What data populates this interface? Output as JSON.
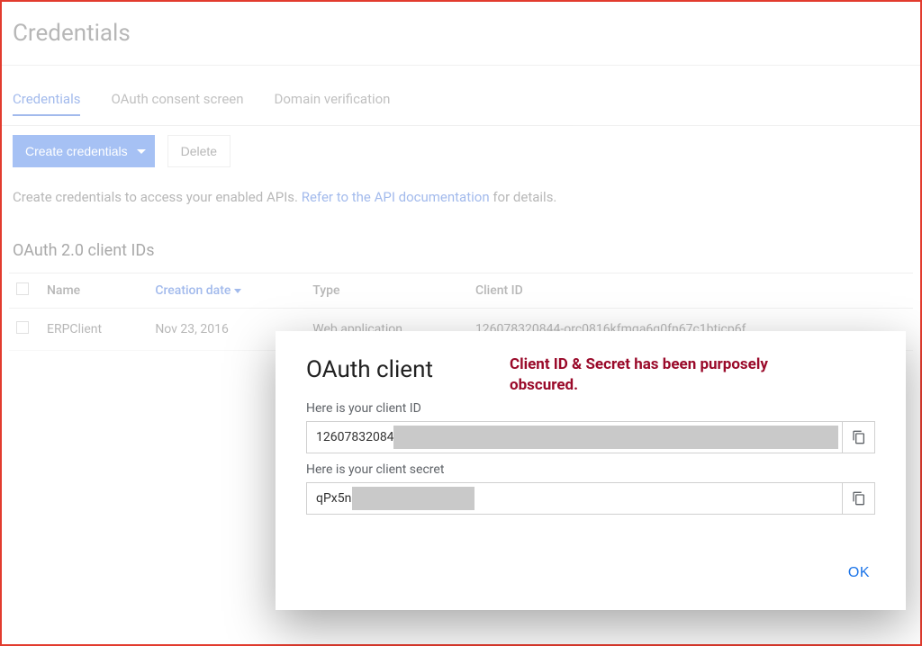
{
  "page": {
    "title": "Credentials"
  },
  "tabs": {
    "credentials": "Credentials",
    "oauth_consent": "OAuth consent screen",
    "domain_verification": "Domain verification"
  },
  "toolbar": {
    "create_label": "Create credentials",
    "delete_label": "Delete"
  },
  "helper": {
    "prefix": "Create credentials to access your enabled APIs. ",
    "link_text": "Refer to the API documentation",
    "suffix": " for details."
  },
  "section": {
    "oauth_heading": "OAuth 2.0 client IDs"
  },
  "table": {
    "headers": {
      "name": "Name",
      "creation_date": "Creation date",
      "type": "Type",
      "client_id": "Client ID"
    },
    "rows": [
      {
        "name": "ERPClient",
        "creation_date": "Nov 23, 2016",
        "type": "Web application",
        "client_id": "126078320844-orc0816kfmqa6q0fn67c1bticp6f"
      }
    ]
  },
  "modal": {
    "title": "OAuth client",
    "annotation": "Client ID & Secret has been purposely obscured.",
    "client_id_label": "Here is your client ID",
    "client_id_value": "12607832084",
    "client_secret_label": "Here is your client secret",
    "client_secret_value": "qPx5n",
    "ok_label": "OK"
  }
}
